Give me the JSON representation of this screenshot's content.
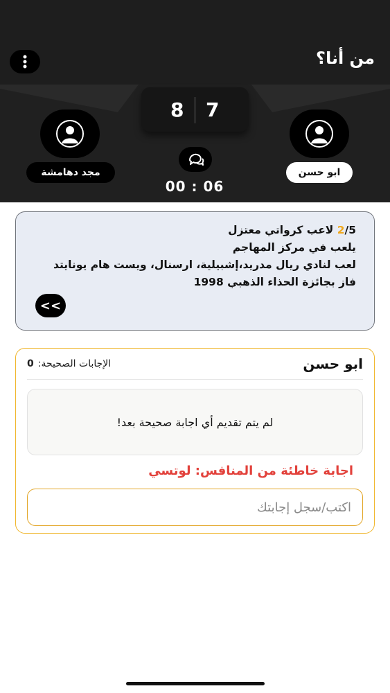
{
  "header": {
    "title": "من أنا؟",
    "menu_icon": "more-vertical-icon"
  },
  "scoreboard": {
    "score_left": "8",
    "score_right": "7",
    "timer": "00 : 06",
    "chat_icon": "chat-bubbles-icon"
  },
  "players": {
    "left": {
      "name": "مجد دهامشة",
      "avatar_icon": "user-icon"
    },
    "right": {
      "name": "ابو حسن",
      "avatar_icon": "user-icon"
    }
  },
  "clue_card": {
    "counter_current": "2",
    "counter_total": "/5",
    "clues": [
      "لاعب كرواتي معتزل",
      "يلعب في مركز المهاجم",
      "لعب لنادي ريال مدريد،إشبيلية، ارسنال، ويست هام يونايتد",
      "فاز بجائزة الحذاء الذهبي 1998"
    ],
    "skip_label": "<<"
  },
  "answer_card": {
    "player_name": "ابو حسن",
    "correct_label": "الإجابات الصحيحة:",
    "correct_count": "0",
    "empty_message": "لم يتم تقديم أي اجابة صحيحة بعد!",
    "wrong_answer": "اجابة خاطئة من المنافس: لوتسي",
    "input_placeholder": "اكتب/سجل إجابتك",
    "input_value": ""
  },
  "colors": {
    "accent": "#f0a81c",
    "error": "#e2413b",
    "dark": "#1e1e1e"
  }
}
